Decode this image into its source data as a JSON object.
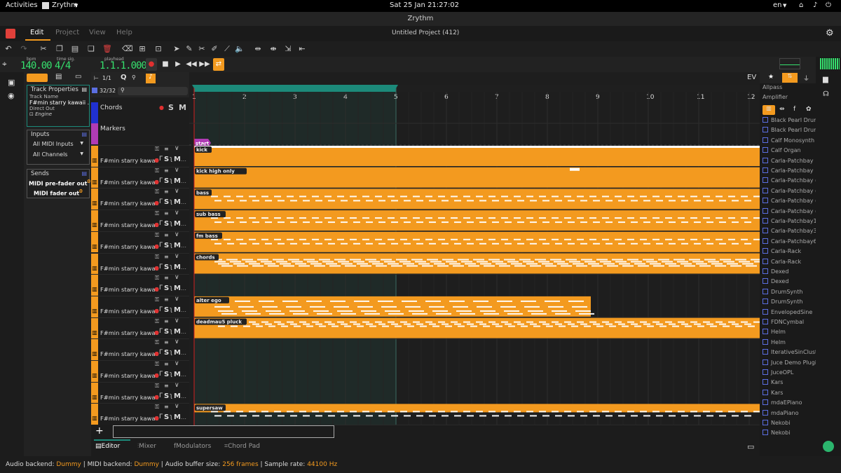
{
  "gnome": {
    "activities": "Activities",
    "app": "Zrythm",
    "clock": "Sat 25 Jan  21:27:02",
    "lang": "en"
  },
  "window": {
    "title": "Zrythm",
    "project": "Untitled Project (412)"
  },
  "menu": [
    "Edit",
    "Project",
    "View",
    "Help"
  ],
  "transport": {
    "bpm_label": "bpm",
    "bpm": "140.00",
    "timesig_label": "time sig.",
    "timesig": "4/4",
    "playhead_label": "playhead",
    "playhead": "1.1.1.000"
  },
  "inspector": {
    "header": "Track Properties",
    "name_label": "Track Name",
    "track_name": "F#min starry kawaii ...",
    "direct_out": "Direct Out",
    "engine": "Engine",
    "inputs_title": "Inputs",
    "midi_inputs": "All MIDI Inputs",
    "channels": "All Channels",
    "sends_title": "Sends",
    "send1": "MIDI pre-fader out",
    "send2": "MIDI fader out"
  },
  "tracklist": {
    "count": "32/32",
    "snap": "1/1",
    "chords": "Chords",
    "markers": "Markers"
  },
  "tracks": [
    {
      "name": "F#min starry kawaii",
      "region": "kick"
    },
    {
      "name": "F#min starry kawaii",
      "region": "kick high only"
    },
    {
      "name": "F#min starry kawaii",
      "region": "bass"
    },
    {
      "name": "F#min starry kawaii",
      "region": "sub bass"
    },
    {
      "name": "F#min starry kawaii",
      "region": "fm bass"
    },
    {
      "name": "F#min starry kawaii",
      "region": "chords"
    },
    {
      "name": "F#min starry kawaii",
      "region": ""
    },
    {
      "name": "F#min starry kawaii",
      "region": "alter ego"
    },
    {
      "name": "F#min starry kawaii",
      "region": "deadmau5 pluck"
    },
    {
      "name": "F#min starry kawaii",
      "region": ""
    },
    {
      "name": "F#min starry kawaii",
      "region": ""
    },
    {
      "name": "F#min starry kawaii",
      "region": ""
    },
    {
      "name": "F#min starry kawaii",
      "region": "supersaw"
    }
  ],
  "marker": "start",
  "ruler": [
    "1",
    "2",
    "3",
    "4",
    "5",
    "6",
    "7",
    "8",
    "9",
    "10",
    "11",
    "12"
  ],
  "plugins_top": [
    "Allpass",
    "Amplifier"
  ],
  "plugins": [
    "Black Pearl Drum",
    "Black Pearl Drum",
    "Calf Monosynth",
    "Calf Organ",
    "Carla-Patchbay",
    "Carla-Patchbay",
    "Carla-Patchbay (",
    "Carla-Patchbay (",
    "Carla-Patchbay (",
    "Carla-Patchbay (",
    "Carla-Patchbay1",
    "Carla-Patchbay3",
    "Carla-Patchbay6",
    "Carla-Rack",
    "Carla-Rack",
    "Dexed",
    "Dexed",
    "DrumSynth",
    "DrumSynth",
    "EnvelopedSine",
    "FDNCymbal",
    "Helm",
    "Helm",
    "IterativeSinClust",
    "Juce Demo Plugi",
    "JuceOPL",
    "Kars",
    "Kars",
    "mdaEPiano",
    "mdaPiano",
    "Nekobi",
    "Nekobi"
  ],
  "right_header": "EV",
  "bottom_tabs": [
    "Editor",
    "Mixer",
    "Modulators",
    "Chord Pad"
  ],
  "status": {
    "audio_label": "Audio backend:",
    "audio": "Dummy",
    "midi_label": "MIDI backend:",
    "midi": "Dummy",
    "buffer_label": "Audio buffer size:",
    "buffer": "256 frames",
    "rate_label": "Sample rate:",
    "rate": "44100 Hz"
  },
  "colors": {
    "accent": "#f39a1f",
    "lcd": "#36e06e",
    "region": "#f39a1f",
    "marker": "#b03bb5",
    "loop": "#1c8a7a"
  }
}
